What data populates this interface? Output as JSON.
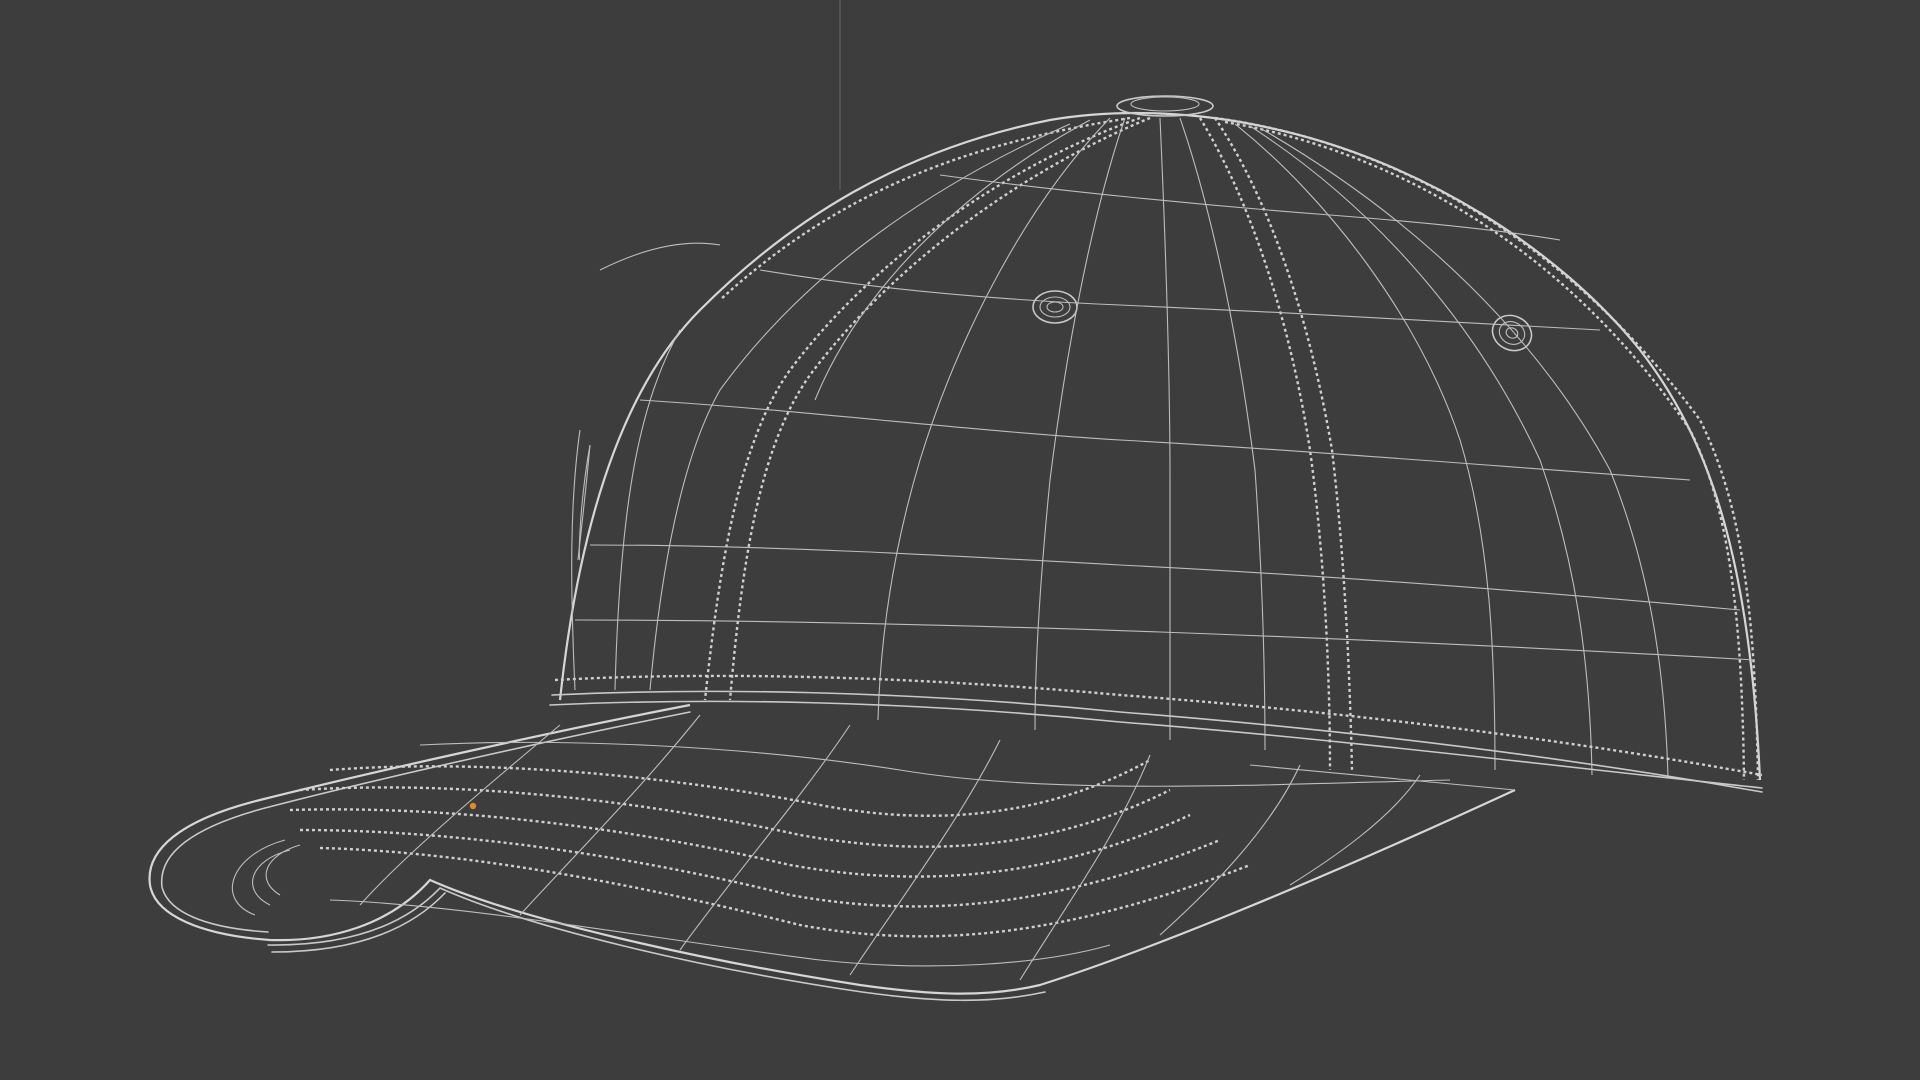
{
  "viewport": {
    "background_color": "#3d3d3d",
    "wire_color": "#c9c9c9",
    "origin_marker_color": "#e08a2a",
    "object_name_icon": "cap-mesh-icon"
  }
}
